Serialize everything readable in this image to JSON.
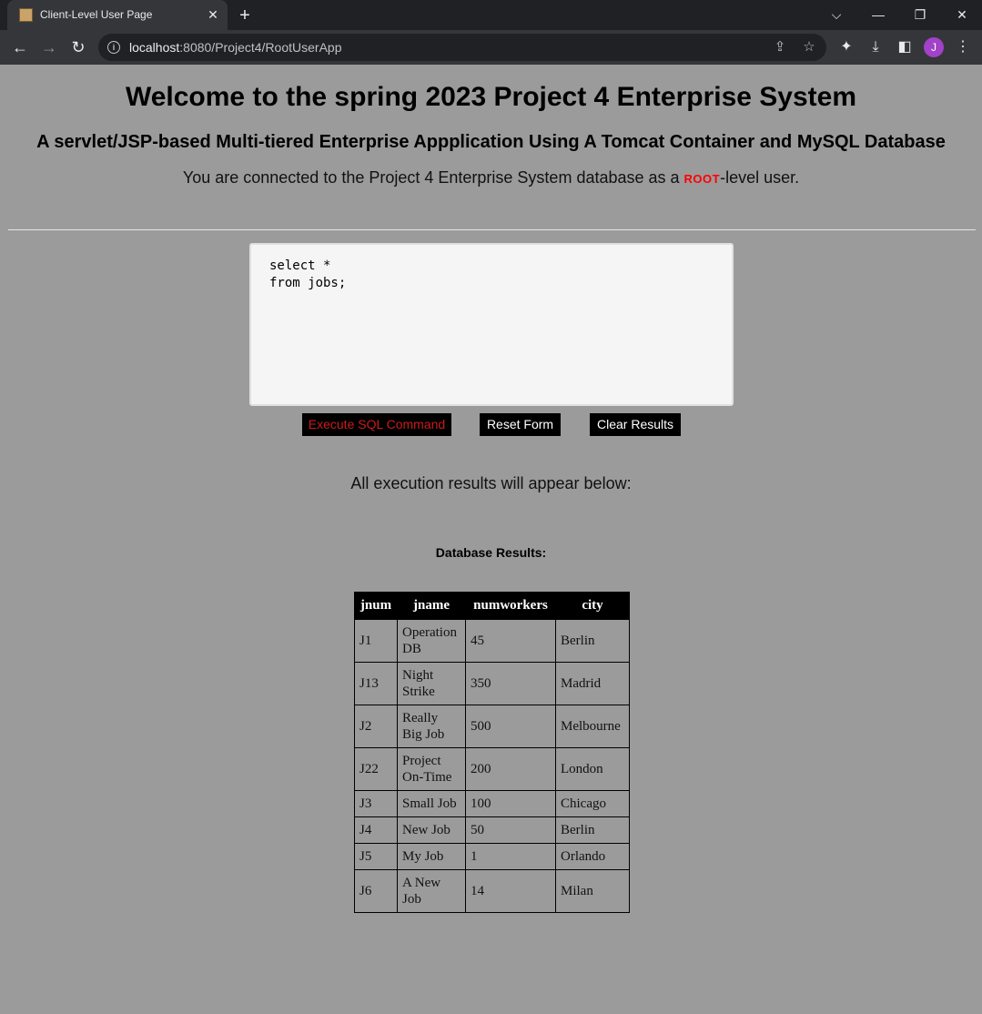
{
  "browser": {
    "tab_title": "Client-Level User Page",
    "url_host": "localhost",
    "url_path": ":8080/Project4/RootUserApp",
    "avatar_letter": "J"
  },
  "header": {
    "title": "Welcome to the spring 2023 Project 4 Enterprise System",
    "subtitle": "A servlet/JSP-based Multi-tiered Enterprise Appplication Using A Tomcat Container and MySQL Database",
    "connected_prefix": "You are connected to the Project 4 Enterprise System database as a ",
    "connected_role": "root",
    "connected_suffix": "-level user."
  },
  "form": {
    "sql_text": "select *\nfrom jobs;",
    "execute_label": "Execute SQL Command",
    "reset_label": "Reset Form",
    "clear_label": "Clear Results"
  },
  "results": {
    "note": "All execution results will appear below:",
    "db_label": "Database Results:",
    "columns": [
      "jnum",
      "jname",
      "numworkers",
      "city"
    ],
    "rows": [
      [
        "J1",
        "Operation DB",
        "45",
        "Berlin"
      ],
      [
        "J13",
        "Night Strike",
        "350",
        "Madrid"
      ],
      [
        "J2",
        "Really Big Job",
        "500",
        "Melbourne"
      ],
      [
        "J22",
        "Project On-Time",
        "200",
        "London"
      ],
      [
        "J3",
        "Small Job",
        "100",
        "Chicago"
      ],
      [
        "J4",
        "New Job",
        "50",
        "Berlin"
      ],
      [
        "J5",
        "My Job",
        "1",
        "Orlando"
      ],
      [
        "J6",
        "A New Job",
        "14",
        "Milan"
      ]
    ]
  },
  "colors": {
    "page_bg": "#9b9b9b",
    "root_accent": "#ff0000",
    "execute_text": "#cc1b1b"
  }
}
